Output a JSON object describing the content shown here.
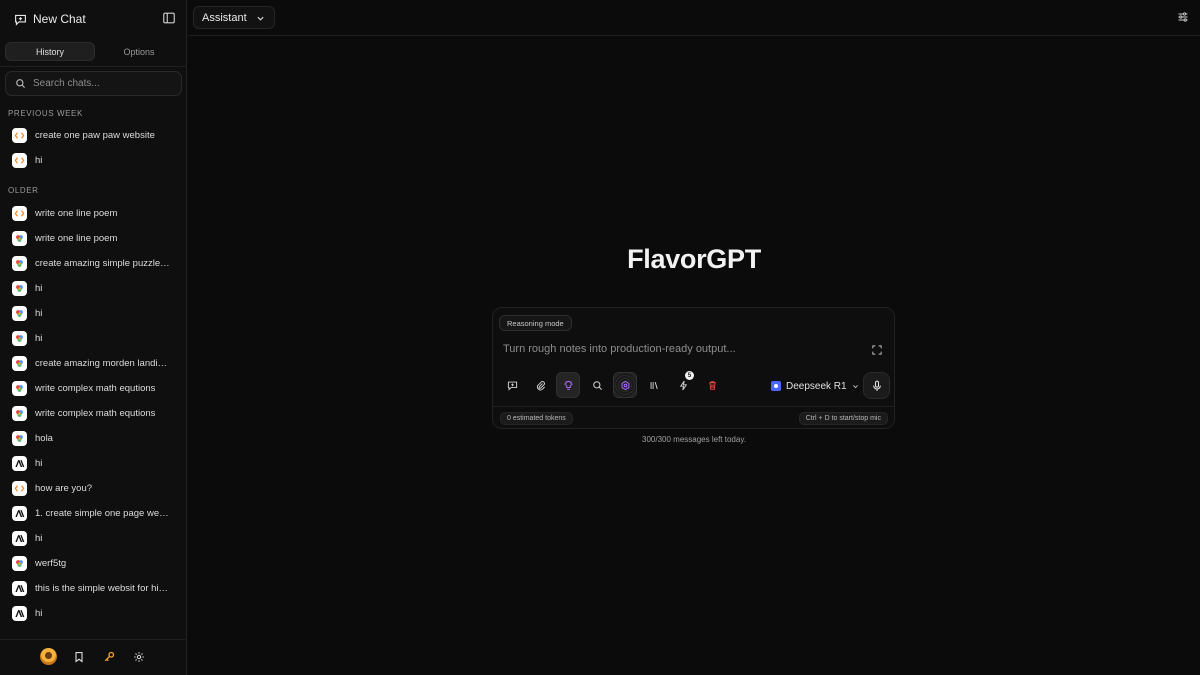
{
  "sidebar": {
    "new_chat_label": "New Chat",
    "tabs": [
      {
        "label": "History",
        "active": true
      },
      {
        "label": "Options",
        "active": false
      }
    ],
    "search_placeholder": "Search chats...",
    "sections": [
      {
        "label": "PREVIOUS WEEK",
        "items": [
          {
            "title": "create one paw paw website",
            "icon": "code-bracket-icon"
          },
          {
            "title": "hi",
            "icon": "code-bracket-icon"
          }
        ]
      },
      {
        "label": "OLDER",
        "items": [
          {
            "title": "write one line poem",
            "icon": "code-bracket-icon"
          },
          {
            "title": "write one line poem",
            "icon": "gemini-icon"
          },
          {
            "title": "create amazing simple puzzle g...",
            "icon": "gemini-icon"
          },
          {
            "title": "hi",
            "icon": "gemini-icon"
          },
          {
            "title": "hi",
            "icon": "gemini-icon"
          },
          {
            "title": "hi",
            "icon": "gemini-icon"
          },
          {
            "title": "create amazing morden landing ...",
            "icon": "gemini-icon"
          },
          {
            "title": "write complex math equtions",
            "icon": "gemini-icon"
          },
          {
            "title": "write complex math equtions",
            "icon": "gemini-icon"
          },
          {
            "title": "hola",
            "icon": "gemini-icon"
          },
          {
            "title": "hi",
            "icon": "anthropic-icon"
          },
          {
            "title": "how are you?",
            "icon": "code-bracket-icon"
          },
          {
            "title": "1. create simple one page websi...",
            "icon": "anthropic-icon"
          },
          {
            "title": "hi",
            "icon": "anthropic-icon"
          },
          {
            "title": "werf5tg",
            "icon": "gemini-icon"
          },
          {
            "title": "this is the simple websit for hiki...",
            "icon": "anthropic-icon"
          },
          {
            "title": "hi",
            "icon": "anthropic-icon"
          }
        ]
      }
    ]
  },
  "topbar": {
    "assistant_label": "Assistant"
  },
  "main": {
    "brand": "FlavorGPT",
    "mode_chip": "Reasoning mode",
    "prompt_placeholder": "Turn rough notes into production-ready output...",
    "tool_badge_count": "5",
    "model_name": "Deepseek R1",
    "tokens_label": "0 estimated tokens",
    "mic_hint": "Ctrl + D to start/stop mic",
    "messages_left": "300/300 messages left today."
  },
  "colors": {
    "background": "#0b0b0b",
    "sidebar": "#0f0f0f",
    "accent_purple": "#b06cff",
    "delete_red": "#e0483e",
    "model_blue": "#4a66ff"
  }
}
